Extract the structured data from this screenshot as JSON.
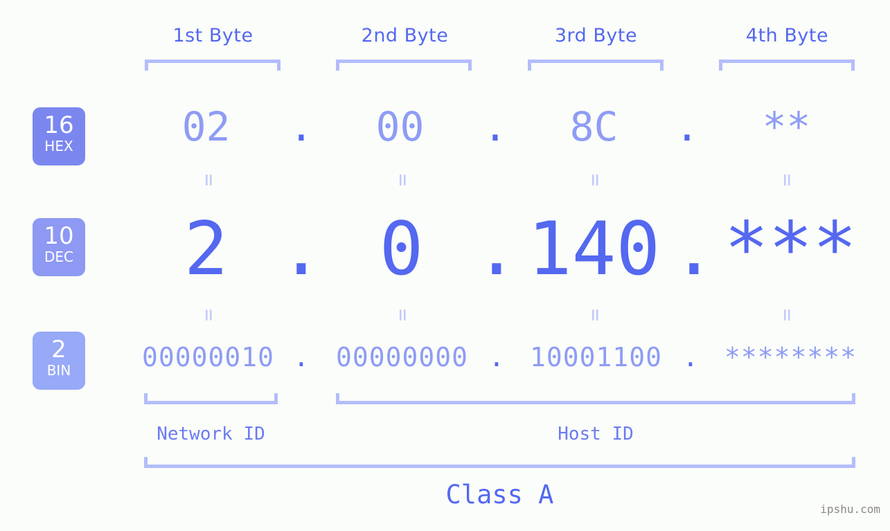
{
  "page": {
    "background_color": "#fbfdfa",
    "watermark": "ipshu.com"
  },
  "colors": {
    "accent_strong": "#5468f0",
    "accent_mid": "#8e9cf5",
    "accent_light": "#b3bdfb",
    "equals_color": "#c2caf9",
    "badge_hex": "#7b87ef",
    "badge_dec": "#8d99f2",
    "badge_bin": "#97a9f7",
    "watermark_color": "#8a8a8a"
  },
  "headers": {
    "bytes": [
      {
        "label": "1st Byte"
      },
      {
        "label": "2nd Byte"
      },
      {
        "label": "3rd Byte"
      },
      {
        "label": "4th Byte"
      }
    ]
  },
  "bases": [
    {
      "number": "16",
      "name": "HEX"
    },
    {
      "number": "10",
      "name": "DEC"
    },
    {
      "number": "2",
      "name": "BIN"
    }
  ],
  "rows": {
    "hex": {
      "base_number": "16",
      "base_name": "HEX",
      "octets": [
        "02",
        "00",
        "8C",
        "**"
      ],
      "separator": "."
    },
    "dec": {
      "base_number": "10",
      "base_name": "DEC",
      "octets": [
        "2",
        "0",
        "140",
        "***"
      ],
      "separator": "."
    },
    "bin": {
      "base_number": "2",
      "base_name": "BIN",
      "octets": [
        "00000010",
        "00000000",
        "10001100",
        "********"
      ],
      "separator": "."
    }
  },
  "equals": {
    "glyph": "=",
    "count_per_row": 4
  },
  "segments": {
    "network_id": "Network ID",
    "host_id": "Host ID",
    "class": "Class A"
  }
}
